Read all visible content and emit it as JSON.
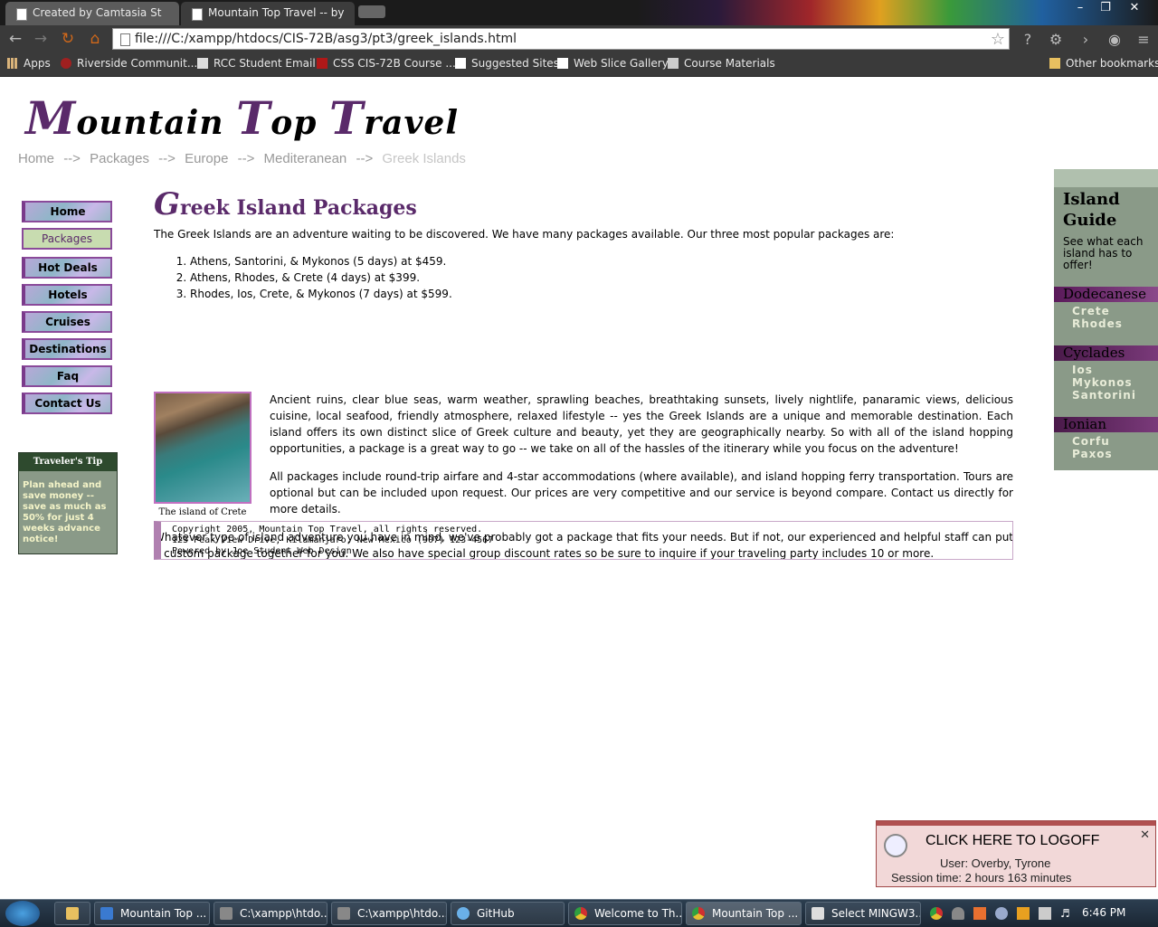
{
  "browser": {
    "tabs": [
      {
        "title": "Created by Camtasia St"
      },
      {
        "title": "Mountain Top Travel -- by"
      }
    ],
    "url": "file:///C:/xampp/htdocs/CIS-72B/asg3/pt3/greek_islands.html",
    "bookmarks": [
      {
        "label": "Apps",
        "icon": "apps-grid-icon"
      },
      {
        "label": "Riverside Communit...",
        "icon": "college-icon"
      },
      {
        "label": "RCC Student Email",
        "icon": "email-icon"
      },
      {
        "label": "CSS CIS-72B Course ...",
        "icon": "course-icon"
      },
      {
        "label": "Suggested Sites",
        "icon": "page-icon"
      },
      {
        "label": "Web Slice Gallery",
        "icon": "page-icon"
      },
      {
        "label": "Course Materials",
        "icon": "doc-icon"
      },
      {
        "label": "Other bookmarks",
        "icon": "folder-icon"
      }
    ]
  },
  "site": {
    "logo": {
      "m": "M",
      "rest1": "ountain ",
      "t1": "T",
      "rest2": "op ",
      "t2": "T",
      "rest3": "ravel"
    },
    "breadcrumb": [
      {
        "label": "Home"
      },
      {
        "label": "Packages"
      },
      {
        "label": "Europe"
      },
      {
        "label": "Mediteranean"
      },
      {
        "label": "Greek Islands"
      }
    ],
    "breadcrumb_sep": "-->",
    "nav": [
      {
        "label": "Home"
      },
      {
        "label": "Packages"
      },
      {
        "label": "Hot Deals"
      },
      {
        "label": "Hotels"
      },
      {
        "label": "Cruises"
      },
      {
        "label": "Destinations"
      },
      {
        "label": "Faq"
      },
      {
        "label": "Contact Us"
      }
    ],
    "tip": {
      "title": "Traveler's Tip",
      "text": "Plan ahead and save money -- save as much as 50% for just 4 weeks advance notice!"
    },
    "main": {
      "heading_first": "G",
      "heading_rest": "reek Island Packages",
      "intro": "The Greek Islands are an adventure waiting to be discovered. We have many packages available. Our three most popular packages are:",
      "packages": [
        "Athens, Santorini, & Mykonos (5 days) at $459.",
        "Athens, Rhodes, & Crete (4 days) at $399.",
        "Rhodes, Ios, Crete, & Mykonos (7 days) at $599."
      ],
      "caption": "The island of Crete",
      "para1": "Ancient ruins, clear blue seas, warm weather, sprawling beaches, breathtaking sunsets, lively nightlife, panaramic views, delicious cuisine, local seafood, friendly atmosphere, relaxed lifestyle -- yes the Greek Islands are a unique and memorable destination. Each island offers its own distinct slice of Greek culture and beauty, yet they are geographically nearby. So with all of the island hopping opportunities, a package is a great way to go -- we take on all of the hassles of the itinerary while you focus on the adventure!",
      "para2": "All packages include round-trip airfare and 4-star accommodations (where available), and island hopping ferry transportation. Tours are optional but can be included upon request. Our prices are very competitive and our service is beyond compare. Contact us directly for more details.",
      "para3": "Whatever type of island adventure you have in mind, we've probably got a package that fits your needs. But if not, our experienced and helpful staff can put a custom package together for you. We also have special group discount rates so be sure to inquire if your traveling party includes 10 or more."
    },
    "footer": {
      "line1": "Copyright 2005, Mountain Top Travel, all rights reserved.",
      "line2": "123 Peak View Drive, Kilamanjaro, New Mexico (907) 123-4567",
      "line3": "Powered by Joe Student Web Design"
    },
    "guide": {
      "title_line1": "Island",
      "title_line2": "Guide",
      "subtitle": "See what each island has to offer!",
      "regions": [
        {
          "name": "Dodecanese",
          "islands": [
            "Crete",
            "Rhodes"
          ]
        },
        {
          "name": "Cyclades",
          "islands": [
            "Ios",
            "Mykonos",
            "Santorini"
          ]
        },
        {
          "name": "Ionian",
          "islands": [
            "Corfu",
            "Paxos"
          ]
        }
      ]
    }
  },
  "logoff": {
    "title": "CLICK HERE TO LOGOFF",
    "user": "User:  Overby, Tyrone",
    "session": "Session time:  2 hours  163 minutes"
  },
  "taskbar": {
    "items": [
      {
        "label": "Mountain Top ...",
        "icon": "ie-icon"
      },
      {
        "label": "C:\\xampp\\htdo...",
        "icon": "editor-icon"
      },
      {
        "label": "C:\\xampp\\htdo...",
        "icon": "editor-icon"
      },
      {
        "label": "GitHub",
        "icon": "github-icon"
      },
      {
        "label": "Welcome to Th...",
        "icon": "chrome-icon"
      },
      {
        "label": "Mountain Top ...",
        "icon": "chrome-icon"
      },
      {
        "label": "Select MINGW3...",
        "icon": "terminal-icon"
      }
    ],
    "clock": "6:46 PM"
  }
}
